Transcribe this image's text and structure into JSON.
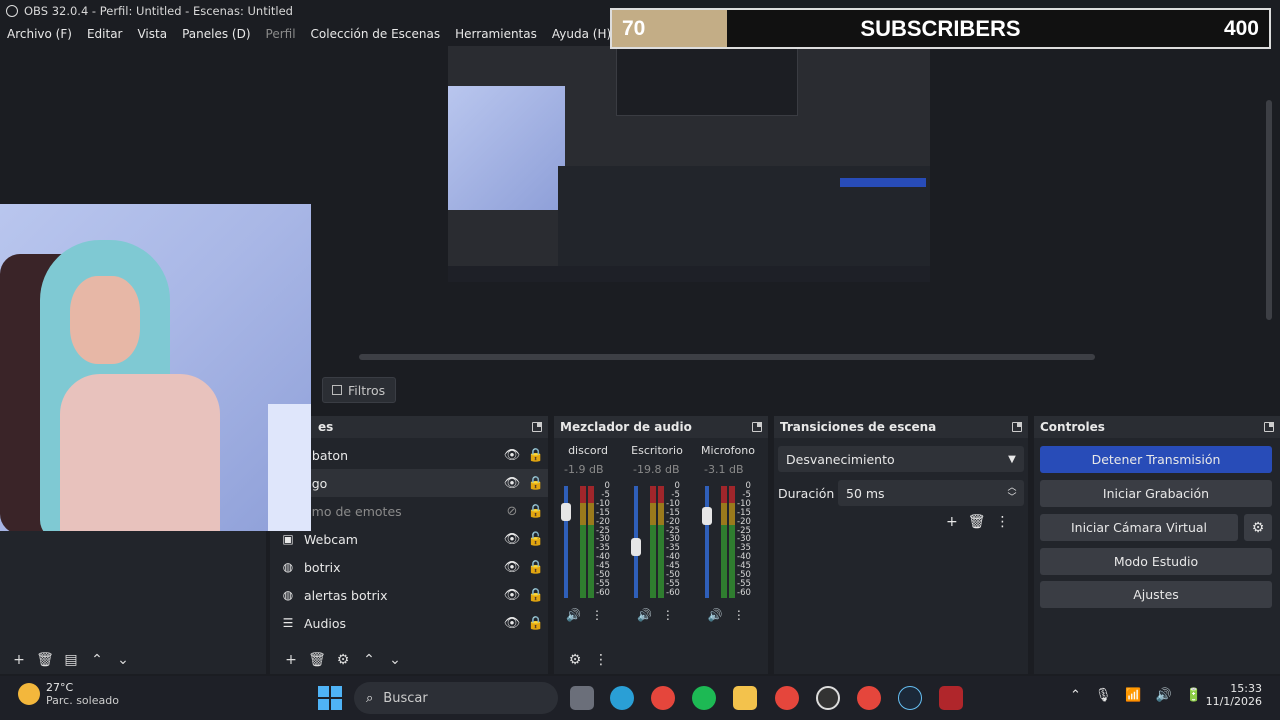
{
  "window": {
    "title": "OBS 32.0.4 - Perfil: Untitled - Escenas: Untitled"
  },
  "menu": [
    "Archivo (F)",
    "Editar",
    "Vista",
    "Paneles (D)",
    "Perfil",
    "Colección de Escenas",
    "Herramientas",
    "Ayuda (H)"
  ],
  "overlay": {
    "current": "70",
    "label": "SUBSCRIBERS",
    "goal": "400",
    "progress": 0.175,
    "fill_color": "#c3ad86"
  },
  "filters_button": "Filtros",
  "sources": {
    "header": "es",
    "items": [
      {
        "name": "ubaton",
        "icon": "",
        "visible": true,
        "locked": true
      },
      {
        "name": "ego",
        "icon": "",
        "visible": true,
        "locked": true,
        "selected": true
      },
      {
        "name": "omo de emotes",
        "icon": "",
        "visible": false,
        "locked": true
      },
      {
        "name": "Webcam",
        "icon": "camera-icon",
        "visible": true,
        "locked": false
      },
      {
        "name": "botrix",
        "icon": "browser-icon",
        "visible": true,
        "locked": true
      },
      {
        "name": "alertas botrix",
        "icon": "browser-icon",
        "visible": true,
        "locked": true
      },
      {
        "name": "Audios",
        "icon": "group-icon",
        "visible": true,
        "locked": true
      }
    ]
  },
  "mixer": {
    "header": "Mezclador de audio",
    "channels": [
      {
        "name": "discord",
        "db": "-1.9 dB",
        "level": 0.82
      },
      {
        "name": "Escritorio",
        "db": "-19.8 dB",
        "level": 0.45
      },
      {
        "name": "Microfono",
        "db": "-3.1 dB",
        "level": 0.78
      }
    ],
    "scale": [
      "0",
      "-5",
      "-10",
      "-15",
      "-20",
      "-25",
      "-30",
      "-35",
      "-40",
      "-45",
      "-50",
      "-55",
      "-60"
    ]
  },
  "transitions": {
    "header": "Transiciones de escena",
    "selected": "Desvanecimiento",
    "duration_label": "Duración",
    "duration_value": "50 ms"
  },
  "controls": {
    "header": "Controles",
    "stop_stream": "Detener Transmisión",
    "start_recording": "Iniciar Grabación",
    "start_virtual_cam": "Iniciar Cámara Virtual",
    "studio_mode": "Modo Estudio",
    "settings": "Ajustes"
  },
  "taskbar": {
    "weather_temp": "27°C",
    "weather_desc": "Parc. soleado",
    "search_placeholder": "Buscar",
    "time": "15:33",
    "date": "11/1/2026"
  }
}
